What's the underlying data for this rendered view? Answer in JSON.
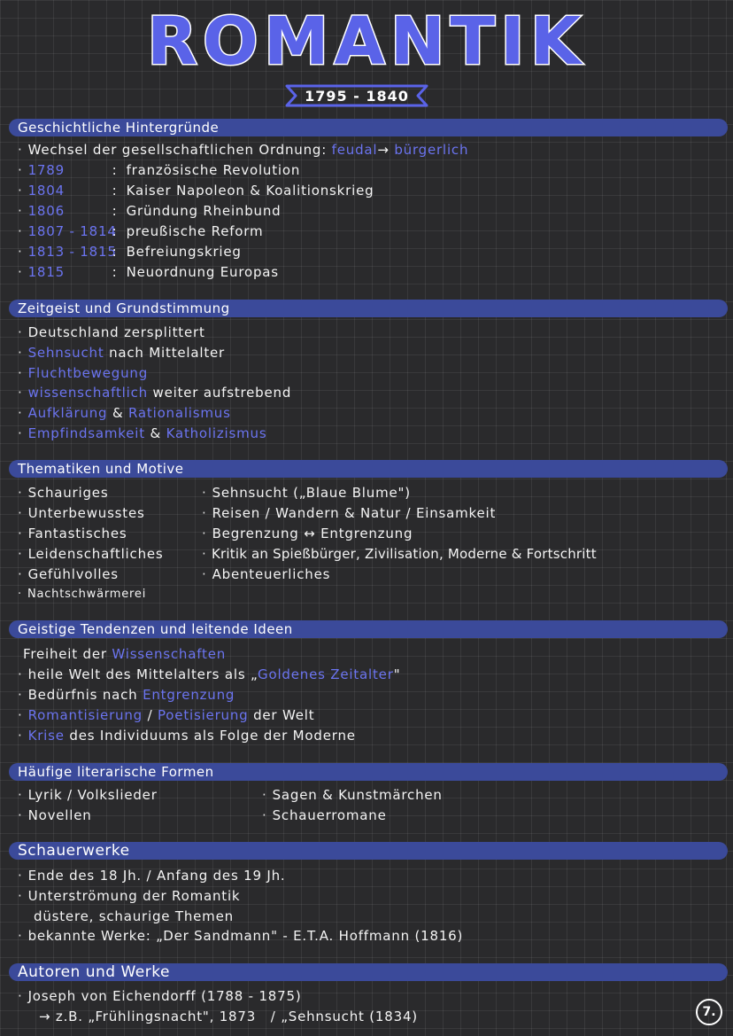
{
  "title": "ROMANTIK",
  "years": "1795 - 1840",
  "sections": {
    "geschichte": {
      "heading": "Geschichtliche Hintergründe",
      "intro_text": "Wechsel der gesellschaftlichen Ordnung:",
      "intro_from": "feudal",
      "intro_arrow": "→",
      "intro_to": "bürgerlich",
      "events": [
        {
          "date": "1789",
          "event": "französische Revolution"
        },
        {
          "date": "1804",
          "event": "Kaiser Napoleon & Koalitionskrieg"
        },
        {
          "date": "1806",
          "event": "Gründung Rheinbund"
        },
        {
          "date": "1807 - 1814",
          "event": "preußische Reform"
        },
        {
          "date": "1813 - 1815",
          "event": "Befreiungskrieg"
        },
        {
          "date": "1815",
          "event": "Neuordnung Europas"
        }
      ]
    },
    "zeitgeist": {
      "heading": "Zeitgeist und Grundstimmung",
      "l1": "Deutschland zersplittert",
      "l2_hl": "Sehnsucht",
      "l2_rest": "nach Mittelalter",
      "l3_hl": "Fluchtbewegung",
      "l4_hl": "wissenschaftlich",
      "l4_rest": "weiter aufstrebend",
      "l5_hl1": "Aufklärung",
      "l5_amp": "&",
      "l5_hl2": "Rationalismus",
      "l6_hl1": "Empfindsamkeit",
      "l6_amp": "&",
      "l6_hl2": "Katholizismus"
    },
    "themen": {
      "heading": "Thematiken und Motive",
      "left": [
        "Schauriges",
        "Unterbewusstes",
        "Fantastisches",
        "Leidenschaftliches",
        "Gefühlvolles",
        "Nachtschwärmerei"
      ],
      "right": [
        "Sehnsucht („Blaue Blume\")",
        "Reisen / Wandern & Natur / Einsamkeit",
        "Begrenzung ↔ Entgrenzung",
        "Kritik an Spießbürger, Zivilisation, Moderne & Fortschritt",
        "Abenteuerliches"
      ]
    },
    "tendenzen": {
      "heading": "Geistige Tendenzen und leitende Ideen",
      "l1_a": "Freiheit der",
      "l1_hl": "Wissenschaften",
      "l2_a": "heile Welt des Mittelalters als „",
      "l2_hl": "Goldenes Zeitalter",
      "l2_b": "\"",
      "l3_a": "Bedürfnis nach",
      "l3_hl": "Entgrenzung",
      "l4_hl1": "Romantisierung",
      "l4_slash": "/",
      "l4_hl2": "Poetisierung",
      "l4_b": "der Welt",
      "l5_hl": "Krise",
      "l5_b": "des Individuums als Folge der Moderne"
    },
    "formen": {
      "heading": "Häufige literarische Formen",
      "left": [
        "Lyrik / Volkslieder",
        "Novellen"
      ],
      "right": [
        "Sagen & Kunstmärchen",
        "Schauerromane"
      ]
    },
    "schauer": {
      "heading": "Schauerwerke",
      "l1": "Ende des 18 Jh. / Anfang des 19 Jh.",
      "l2": "Unterströmung der Romantik",
      "l3": "düstere, schaurige Themen",
      "l4": "bekannte Werke: „Der Sandmann\" - E.T.A. Hoffmann (1816)"
    },
    "autoren": {
      "heading": "Autoren und Werke",
      "l1": "Joseph von Eichendorff (1788 - 1875)",
      "l2": "→ z.B. „Frühlingsnacht\", 1873   / „Sehnsucht (1834)"
    }
  },
  "page_number": "7."
}
